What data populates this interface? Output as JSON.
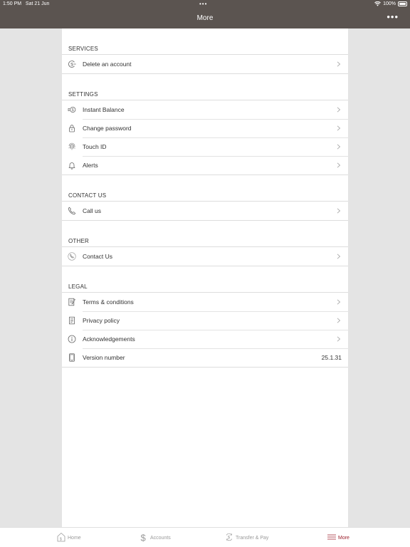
{
  "status": {
    "time": "1:50 PM",
    "date": "Sat 21 Jun",
    "battery": "100%"
  },
  "header": {
    "title": "More"
  },
  "sections": [
    {
      "title": "SERVICES",
      "items": [
        {
          "label": "Delete an account",
          "icon": "dollar-circle-icon"
        }
      ]
    },
    {
      "title": "SETTINGS",
      "items": [
        {
          "label": "Instant Balance",
          "icon": "instant-balance-icon"
        },
        {
          "label": "Change password",
          "icon": "lock-icon"
        },
        {
          "label": "Touch ID",
          "icon": "fingerprint-icon"
        },
        {
          "label": "Alerts",
          "icon": "bell-icon"
        }
      ]
    },
    {
      "title": "CONTACT US",
      "items": [
        {
          "label": "Call us",
          "icon": "phone-icon"
        }
      ]
    },
    {
      "title": "OTHER",
      "items": [
        {
          "label": "Contact Us",
          "icon": "phone-circle-icon"
        }
      ]
    },
    {
      "title": "LEGAL",
      "items": [
        {
          "label": "Terms & conditions",
          "icon": "document-pen-icon"
        },
        {
          "label": "Privacy policy",
          "icon": "document-icon"
        },
        {
          "label": "Acknowledgements",
          "icon": "info-icon"
        },
        {
          "label": "Version number",
          "icon": "tablet-icon",
          "value": "25.1.31"
        }
      ]
    }
  ],
  "tabs": [
    {
      "label": "Home",
      "icon": "home-icon"
    },
    {
      "label": "Accounts",
      "icon": "dollar-icon"
    },
    {
      "label": "Transfer & Pay",
      "icon": "transfer-icon"
    },
    {
      "label": "More",
      "icon": "hamburger-icon",
      "active": true
    }
  ],
  "colors": {
    "header": "#5b5450",
    "accent": "#9c1f2b",
    "background": "#e4e4e4"
  }
}
